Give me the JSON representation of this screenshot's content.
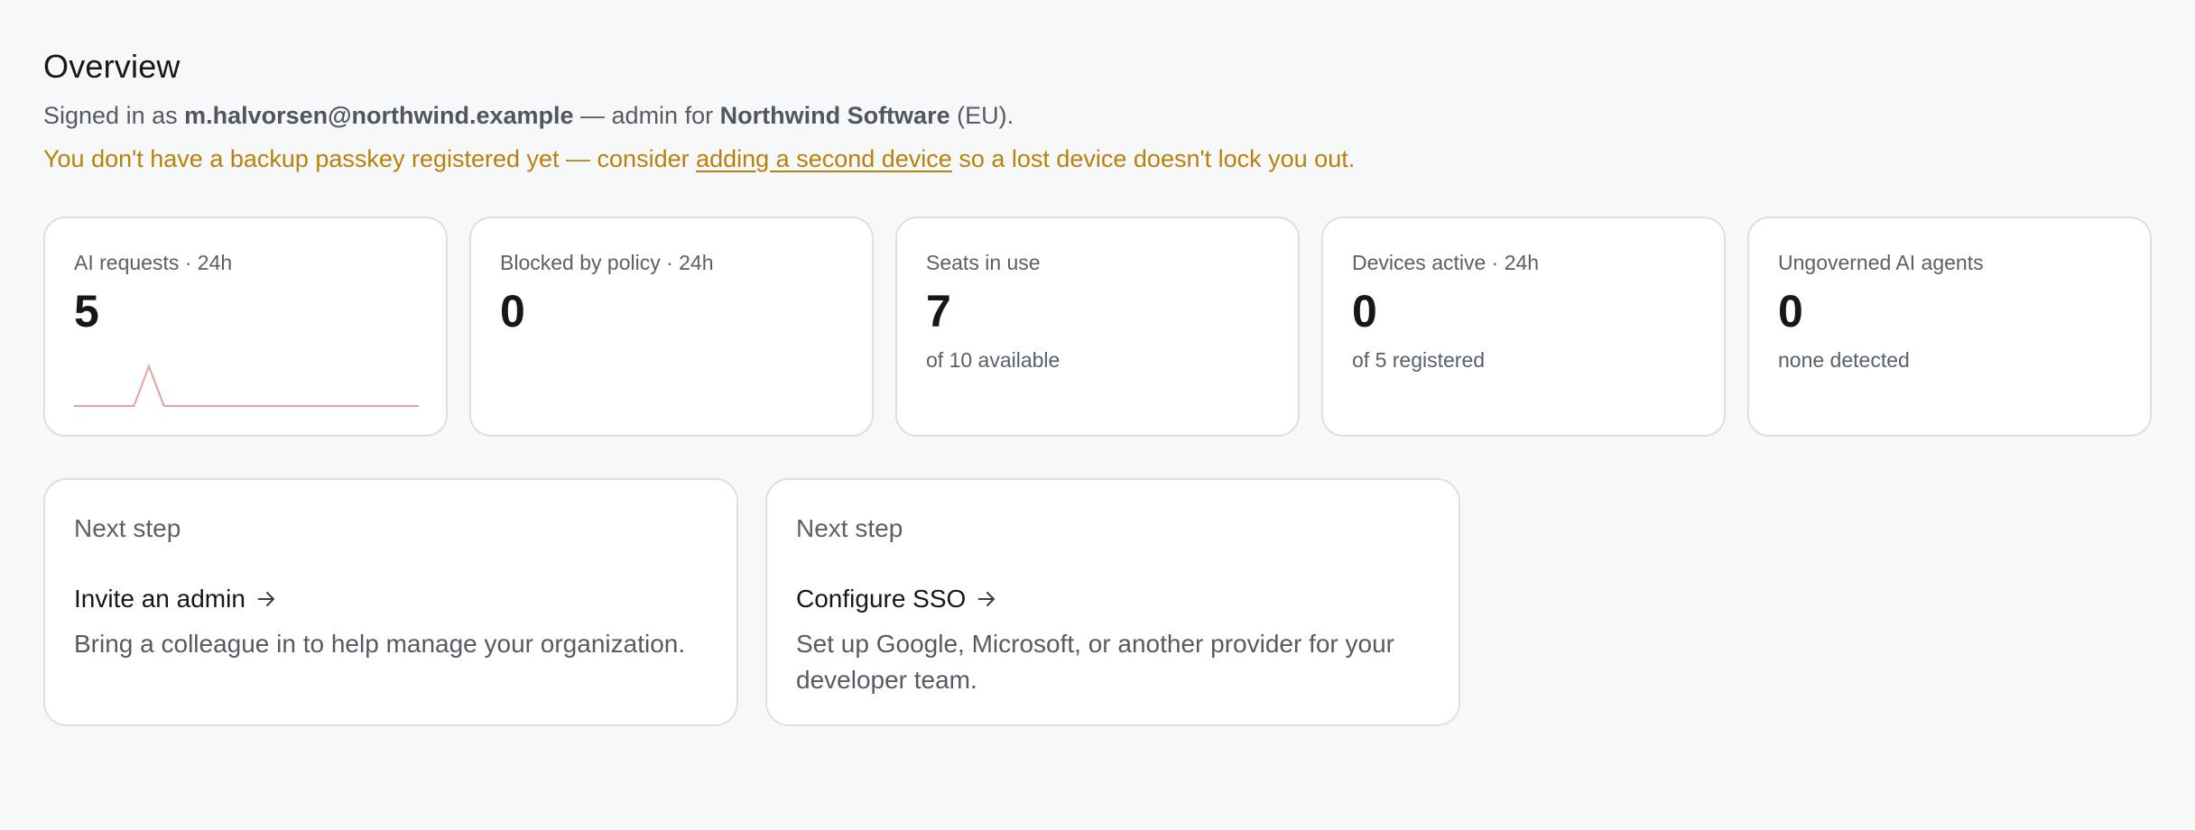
{
  "header": {
    "title": "Overview",
    "signed_in_prefix": "Signed in as ",
    "user_email": "m.halvorsen@northwind.example",
    "signed_in_middle": " — admin for ",
    "org_name": "Northwind Software",
    "region": " (EU)."
  },
  "warning": {
    "prefix": "You don't have a backup passkey registered yet — consider ",
    "link_text": "adding a second device",
    "suffix": " so a lost device doesn't lock you out.",
    "color": "#b8820a"
  },
  "stats": [
    {
      "label": "AI requests · 24h",
      "value": "5",
      "sub": ""
    },
    {
      "label": "Blocked by policy · 24h",
      "value": "0",
      "sub": ""
    },
    {
      "label": "Seats in use",
      "value": "7",
      "sub": "of 10 available"
    },
    {
      "label": "Devices active · 24h",
      "value": "0",
      "sub": "of 5 registered"
    },
    {
      "label": "Ungoverned AI agents",
      "value": "0",
      "sub": "none detected"
    }
  ],
  "sparkline": {
    "values": [
      0,
      0,
      0,
      0,
      0,
      1,
      0,
      0,
      0,
      0,
      0,
      0,
      0,
      0,
      0,
      0,
      0,
      0,
      0,
      0,
      0,
      0,
      0,
      0
    ],
    "color": "#e8a0a0"
  },
  "next_steps": [
    {
      "kicker": "Next step",
      "title": "Invite an admin",
      "description": "Bring a colleague in to help manage your organization.",
      "icon": "arrow-right-icon"
    },
    {
      "kicker": "Next step",
      "title": "Configure SSO",
      "description": "Set up Google, Microsoft, or another provider for your developer team.",
      "icon": "arrow-right-icon"
    }
  ]
}
